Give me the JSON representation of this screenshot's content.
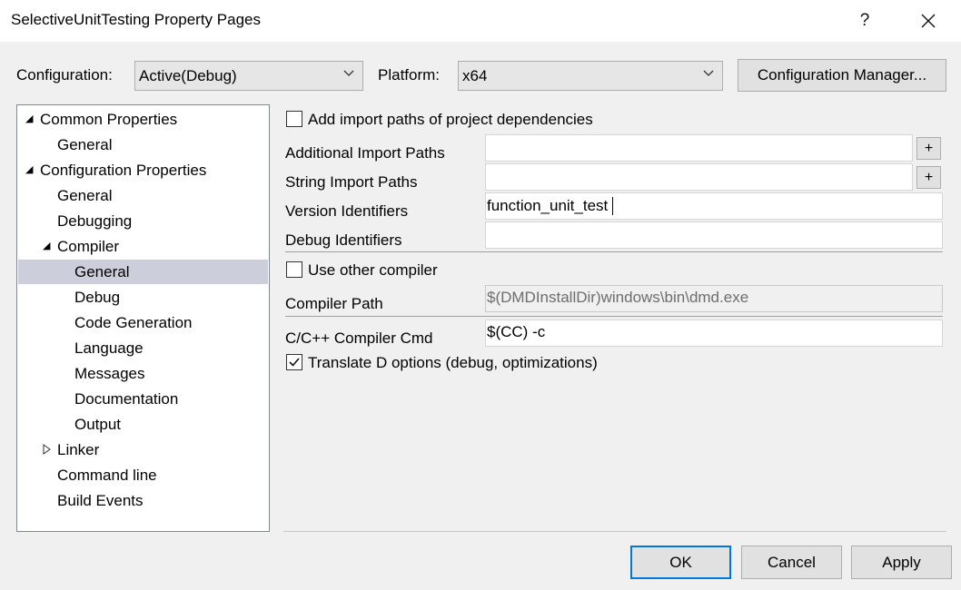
{
  "window": {
    "title": "SelectiveUnitTesting Property Pages",
    "help_label": "?",
    "close_label": "✕"
  },
  "toolbar": {
    "configuration_label": "Configuration:",
    "configuration_value": "Active(Debug)",
    "platform_label": "Platform:",
    "platform_value": "x64",
    "config_manager_label": "Configuration Manager..."
  },
  "tree": {
    "items": [
      {
        "label": "Common Properties"
      },
      {
        "label": "General"
      },
      {
        "label": "Configuration Properties"
      },
      {
        "label": "General"
      },
      {
        "label": "Debugging"
      },
      {
        "label": "Compiler"
      },
      {
        "label": "General"
      },
      {
        "label": "Debug"
      },
      {
        "label": "Code Generation"
      },
      {
        "label": "Language"
      },
      {
        "label": "Messages"
      },
      {
        "label": "Documentation"
      },
      {
        "label": "Output"
      },
      {
        "label": "Linker"
      },
      {
        "label": "Command line"
      },
      {
        "label": "Build Events"
      }
    ],
    "selected": "General"
  },
  "props": {
    "add_import_paths_label": "Add import paths of project dependencies",
    "add_import_paths_checked": false,
    "additional_import_paths_label": "Additional Import Paths",
    "additional_import_paths_value": "",
    "string_import_paths_label": "String Import Paths",
    "string_import_paths_value": "",
    "plus_label": "+",
    "version_identifiers_label": "Version Identifiers",
    "version_identifiers_value": "function_unit_test",
    "debug_identifiers_label": "Debug Identifiers",
    "debug_identifiers_value": "",
    "use_other_compiler_label": "Use other compiler",
    "use_other_compiler_checked": false,
    "compiler_path_label": "Compiler Path",
    "compiler_path_value": "$(DMDInstallDir)windows\\bin\\dmd.exe",
    "cc_cmd_label": "C/C++ Compiler Cmd",
    "cc_cmd_value": "$(CC) -c",
    "translate_d_label": "Translate D options (debug, optimizations)",
    "translate_d_checked": true
  },
  "footer": {
    "ok_label": "OK",
    "cancel_label": "Cancel",
    "apply_label": "Apply"
  }
}
